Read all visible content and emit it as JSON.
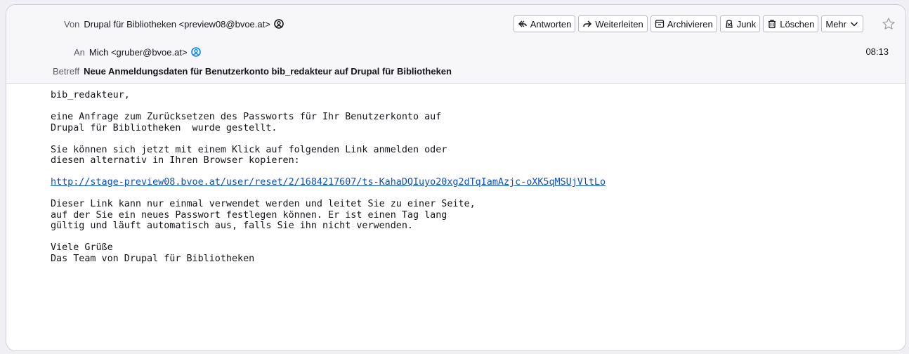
{
  "header": {
    "from_label": "Von",
    "from_value": "Drupal für Bibliotheken <preview08@bvoe.at>",
    "to_label": "An",
    "to_value": "Mich <gruber@bvoe.at>",
    "subject_label": "Betreff",
    "subject_value": "Neue Anmeldungsdaten für Benutzerkonto bib_redakteur auf Drupal für Bibliotheken",
    "time": "08:13"
  },
  "toolbar": {
    "reply": "Antworten",
    "forward": "Weiterleiten",
    "archive": "Archivieren",
    "junk": "Junk",
    "delete": "Löschen",
    "more": "Mehr"
  },
  "message": {
    "greeting": "bib_redakteur,",
    "p1_line1": "eine Anfrage zum Zurücksetzen des Passworts für Ihr Benutzerkonto auf",
    "p1_line2": "Drupal für Bibliotheken  wurde gestellt.",
    "p2_line1": "Sie können sich jetzt mit einem Klick auf folgenden Link anmelden oder",
    "p2_line2": "diesen alternativ in Ihren Browser kopieren:",
    "link": "http://stage-preview08.bvoe.at/user/reset/2/1684217607/ts-KahaDQIuyo20xg2dTqIamAzjc-oXK5qMSUjVltLo",
    "p3_line1": "Dieser Link kann nur einmal verwendet werden und leitet Sie zu einer Seite,",
    "p3_line2": "auf der Sie ein neues Passwort festlegen können. Er ist einen Tag lang",
    "p3_line3": "gültig und läuft automatisch aus, falls Sie ihn nicht verwenden.",
    "closing1": "Viele Grüße",
    "closing2": "Das Team von Drupal für Bibliotheken"
  },
  "colors": {
    "link": "#0b4fcf",
    "contact_blue": "#0a84ff"
  }
}
